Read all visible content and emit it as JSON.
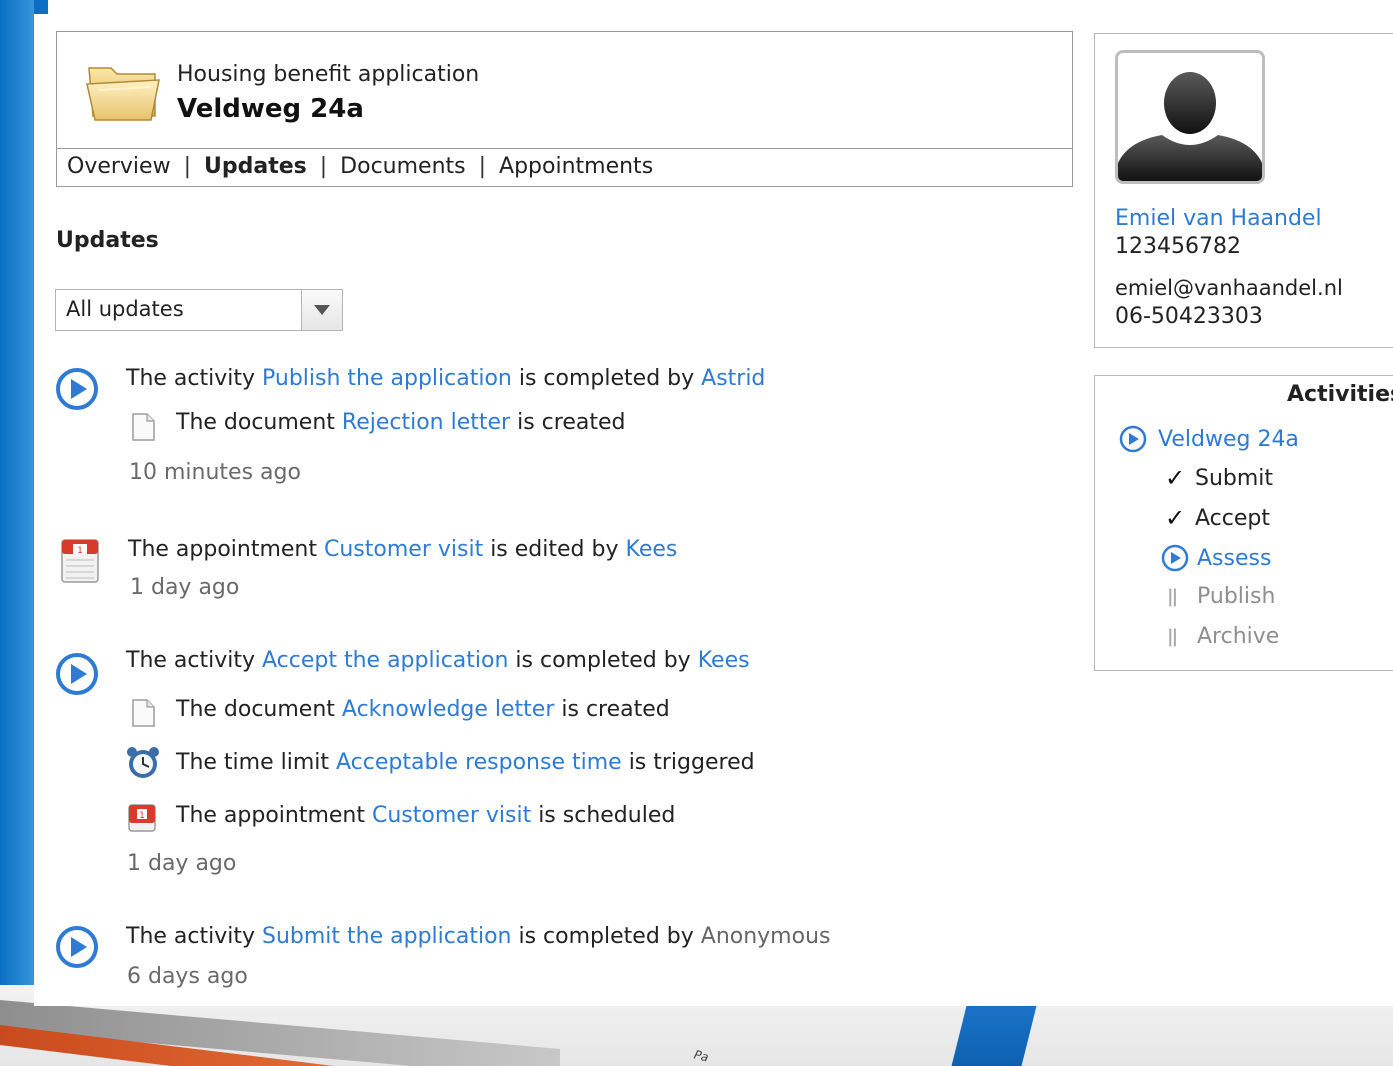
{
  "case": {
    "subtitle": "Housing benefit application",
    "title": "Veldweg 24a",
    "tabs": [
      {
        "label": "Overview"
      },
      {
        "label": "Updates"
      },
      {
        "label": "Documents"
      },
      {
        "label": "Appointments"
      }
    ]
  },
  "updates": {
    "heading": "Updates",
    "filter": {
      "selected": "All updates"
    }
  },
  "feed": [
    {
      "lines": [
        {
          "pre": "The activity ",
          "link": "Publish the application",
          "mid": " is completed by ",
          "actor": "Astrid"
        },
        {
          "pre": "The document ",
          "link": "Rejection letter",
          "post": " is created"
        }
      ],
      "time": "10 minutes ago"
    },
    {
      "lines": [
        {
          "pre": "The appointment ",
          "link": "Customer visit",
          "mid": " is edited by ",
          "actor": "Kees"
        }
      ],
      "time": "1 day ago"
    },
    {
      "lines": [
        {
          "pre": "The activity ",
          "link": "Accept the application",
          "mid": " is completed by ",
          "actor": "Kees"
        },
        {
          "pre": "The document ",
          "link": "Acknowledge letter",
          "post": " is created"
        },
        {
          "pre": "The time limit ",
          "link": "Acceptable response time",
          "post": " is triggered"
        },
        {
          "pre": "The appointment ",
          "link": "Customer visit",
          "post": " is scheduled"
        }
      ],
      "time": "1 day ago"
    },
    {
      "lines": [
        {
          "pre": "The activity ",
          "link": "Submit the application",
          "mid": " is completed by ",
          "actor": "Anonymous"
        }
      ],
      "time": "6 days ago"
    }
  ],
  "person": {
    "name": "Emiel van Haandel",
    "id": "123456782",
    "email": "emiel@vanhaandel.nl",
    "phone": "06-50423303"
  },
  "activities": {
    "title": "Activities",
    "case_link": "Veldweg 24a",
    "items": [
      {
        "label": "Submit",
        "status": "done"
      },
      {
        "label": "Accept",
        "status": "done"
      },
      {
        "label": "Assess",
        "status": "active"
      },
      {
        "label": "Publish",
        "status": "pending"
      },
      {
        "label": "Archive",
        "status": "pending"
      }
    ]
  },
  "background": {
    "fragment": "Pa"
  },
  "colors": {
    "link": "#2e7bd6",
    "text": "#222222",
    "muted": "#6a6a6a",
    "border": "#9a9a9a"
  }
}
